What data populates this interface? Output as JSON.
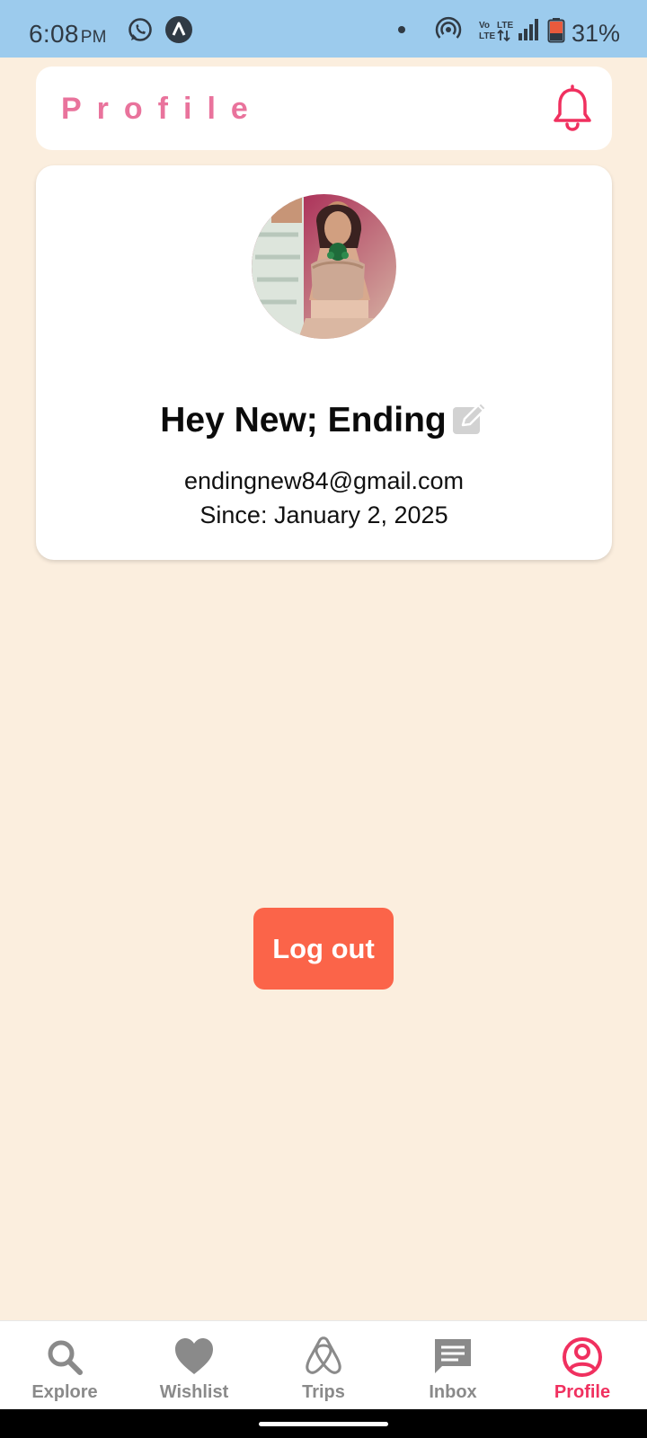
{
  "status_bar": {
    "time": "6:08",
    "ampm": "PM",
    "battery": "31%",
    "icons": [
      "whatsapp-icon",
      "app-notification-icon",
      "dot-icon",
      "hotspot-icon",
      "volte-icon",
      "signal-icon",
      "battery-icon"
    ]
  },
  "header": {
    "title": "Profile",
    "notification_icon": "bell-icon"
  },
  "profile": {
    "greeting": "Hey New; Ending",
    "email": "endingnew84@gmail.com",
    "since": "Since: January 2, 2025",
    "edit_icon": "edit-icon"
  },
  "logout_label": "Log out",
  "nav": {
    "items": [
      {
        "label": "Explore",
        "icon": "search-icon"
      },
      {
        "label": "Wishlist",
        "icon": "heart-icon"
      },
      {
        "label": "Trips",
        "icon": "airbnb-icon"
      },
      {
        "label": "Inbox",
        "icon": "message-icon"
      },
      {
        "label": "Profile",
        "icon": "user-circle-icon"
      }
    ],
    "active": "Profile"
  },
  "colors": {
    "background": "#fbeede",
    "status_bar": "#9ccbed",
    "title_pink": "#e9739c",
    "bell_red": "#f0305f",
    "logout_orange": "#fb6449",
    "nav_active": "#f0305f",
    "nav_inactive": "#8a8a8a"
  }
}
